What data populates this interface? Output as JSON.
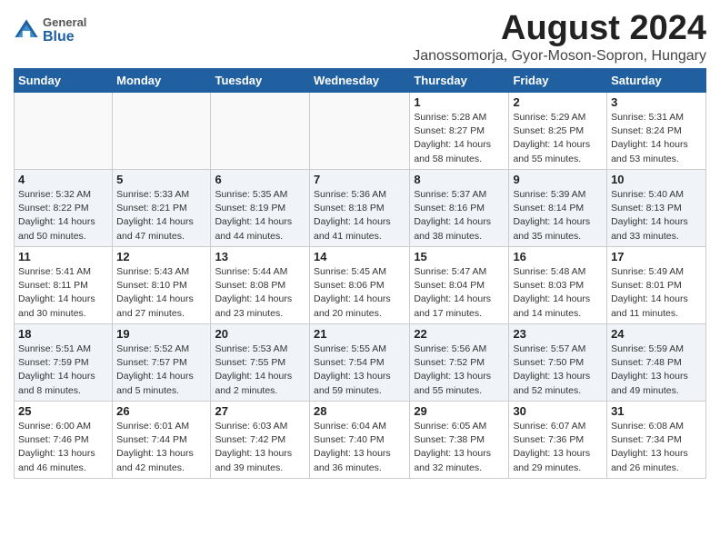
{
  "logo": {
    "general": "General",
    "blue": "Blue"
  },
  "header": {
    "month_year": "August 2024",
    "location": "Janossomorja, Gyor-Moson-Sopron, Hungary"
  },
  "weekdays": [
    "Sunday",
    "Monday",
    "Tuesday",
    "Wednesday",
    "Thursday",
    "Friday",
    "Saturday"
  ],
  "weeks": [
    [
      {
        "day": "",
        "info": ""
      },
      {
        "day": "",
        "info": ""
      },
      {
        "day": "",
        "info": ""
      },
      {
        "day": "",
        "info": ""
      },
      {
        "day": "1",
        "info": "Sunrise: 5:28 AM\nSunset: 8:27 PM\nDaylight: 14 hours\nand 58 minutes."
      },
      {
        "day": "2",
        "info": "Sunrise: 5:29 AM\nSunset: 8:25 PM\nDaylight: 14 hours\nand 55 minutes."
      },
      {
        "day": "3",
        "info": "Sunrise: 5:31 AM\nSunset: 8:24 PM\nDaylight: 14 hours\nand 53 minutes."
      }
    ],
    [
      {
        "day": "4",
        "info": "Sunrise: 5:32 AM\nSunset: 8:22 PM\nDaylight: 14 hours\nand 50 minutes."
      },
      {
        "day": "5",
        "info": "Sunrise: 5:33 AM\nSunset: 8:21 PM\nDaylight: 14 hours\nand 47 minutes."
      },
      {
        "day": "6",
        "info": "Sunrise: 5:35 AM\nSunset: 8:19 PM\nDaylight: 14 hours\nand 44 minutes."
      },
      {
        "day": "7",
        "info": "Sunrise: 5:36 AM\nSunset: 8:18 PM\nDaylight: 14 hours\nand 41 minutes."
      },
      {
        "day": "8",
        "info": "Sunrise: 5:37 AM\nSunset: 8:16 PM\nDaylight: 14 hours\nand 38 minutes."
      },
      {
        "day": "9",
        "info": "Sunrise: 5:39 AM\nSunset: 8:14 PM\nDaylight: 14 hours\nand 35 minutes."
      },
      {
        "day": "10",
        "info": "Sunrise: 5:40 AM\nSunset: 8:13 PM\nDaylight: 14 hours\nand 33 minutes."
      }
    ],
    [
      {
        "day": "11",
        "info": "Sunrise: 5:41 AM\nSunset: 8:11 PM\nDaylight: 14 hours\nand 30 minutes."
      },
      {
        "day": "12",
        "info": "Sunrise: 5:43 AM\nSunset: 8:10 PM\nDaylight: 14 hours\nand 27 minutes."
      },
      {
        "day": "13",
        "info": "Sunrise: 5:44 AM\nSunset: 8:08 PM\nDaylight: 14 hours\nand 23 minutes."
      },
      {
        "day": "14",
        "info": "Sunrise: 5:45 AM\nSunset: 8:06 PM\nDaylight: 14 hours\nand 20 minutes."
      },
      {
        "day": "15",
        "info": "Sunrise: 5:47 AM\nSunset: 8:04 PM\nDaylight: 14 hours\nand 17 minutes."
      },
      {
        "day": "16",
        "info": "Sunrise: 5:48 AM\nSunset: 8:03 PM\nDaylight: 14 hours\nand 14 minutes."
      },
      {
        "day": "17",
        "info": "Sunrise: 5:49 AM\nSunset: 8:01 PM\nDaylight: 14 hours\nand 11 minutes."
      }
    ],
    [
      {
        "day": "18",
        "info": "Sunrise: 5:51 AM\nSunset: 7:59 PM\nDaylight: 14 hours\nand 8 minutes."
      },
      {
        "day": "19",
        "info": "Sunrise: 5:52 AM\nSunset: 7:57 PM\nDaylight: 14 hours\nand 5 minutes."
      },
      {
        "day": "20",
        "info": "Sunrise: 5:53 AM\nSunset: 7:55 PM\nDaylight: 14 hours\nand 2 minutes."
      },
      {
        "day": "21",
        "info": "Sunrise: 5:55 AM\nSunset: 7:54 PM\nDaylight: 13 hours\nand 59 minutes."
      },
      {
        "day": "22",
        "info": "Sunrise: 5:56 AM\nSunset: 7:52 PM\nDaylight: 13 hours\nand 55 minutes."
      },
      {
        "day": "23",
        "info": "Sunrise: 5:57 AM\nSunset: 7:50 PM\nDaylight: 13 hours\nand 52 minutes."
      },
      {
        "day": "24",
        "info": "Sunrise: 5:59 AM\nSunset: 7:48 PM\nDaylight: 13 hours\nand 49 minutes."
      }
    ],
    [
      {
        "day": "25",
        "info": "Sunrise: 6:00 AM\nSunset: 7:46 PM\nDaylight: 13 hours\nand 46 minutes."
      },
      {
        "day": "26",
        "info": "Sunrise: 6:01 AM\nSunset: 7:44 PM\nDaylight: 13 hours\nand 42 minutes."
      },
      {
        "day": "27",
        "info": "Sunrise: 6:03 AM\nSunset: 7:42 PM\nDaylight: 13 hours\nand 39 minutes."
      },
      {
        "day": "28",
        "info": "Sunrise: 6:04 AM\nSunset: 7:40 PM\nDaylight: 13 hours\nand 36 minutes."
      },
      {
        "day": "29",
        "info": "Sunrise: 6:05 AM\nSunset: 7:38 PM\nDaylight: 13 hours\nand 32 minutes."
      },
      {
        "day": "30",
        "info": "Sunrise: 6:07 AM\nSunset: 7:36 PM\nDaylight: 13 hours\nand 29 minutes."
      },
      {
        "day": "31",
        "info": "Sunrise: 6:08 AM\nSunset: 7:34 PM\nDaylight: 13 hours\nand 26 minutes."
      }
    ]
  ]
}
